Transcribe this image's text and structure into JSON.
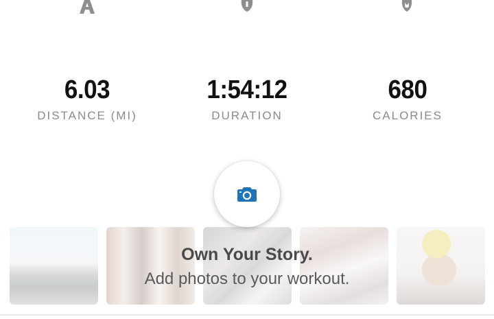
{
  "top_icons": [
    {
      "icon": "distance-icon"
    },
    {
      "icon": "stopwatch-icon"
    },
    {
      "icon": "calories-icon"
    }
  ],
  "stats": {
    "distance": {
      "value": "6.03",
      "label": "DISTANCE (MI)"
    },
    "duration": {
      "value": "1:54:12",
      "label": "DURATION"
    },
    "calories": {
      "value": "680",
      "label": "CALORIES"
    }
  },
  "camera_button": {
    "icon": "camera-icon",
    "color": "#1f73b7"
  },
  "promo": {
    "title": "Own Your Story.",
    "subtitle": "Add photos to your workout."
  },
  "colors": {
    "value_text": "#111111",
    "label_text": "#8a8a8a",
    "accent": "#1f73b7"
  }
}
